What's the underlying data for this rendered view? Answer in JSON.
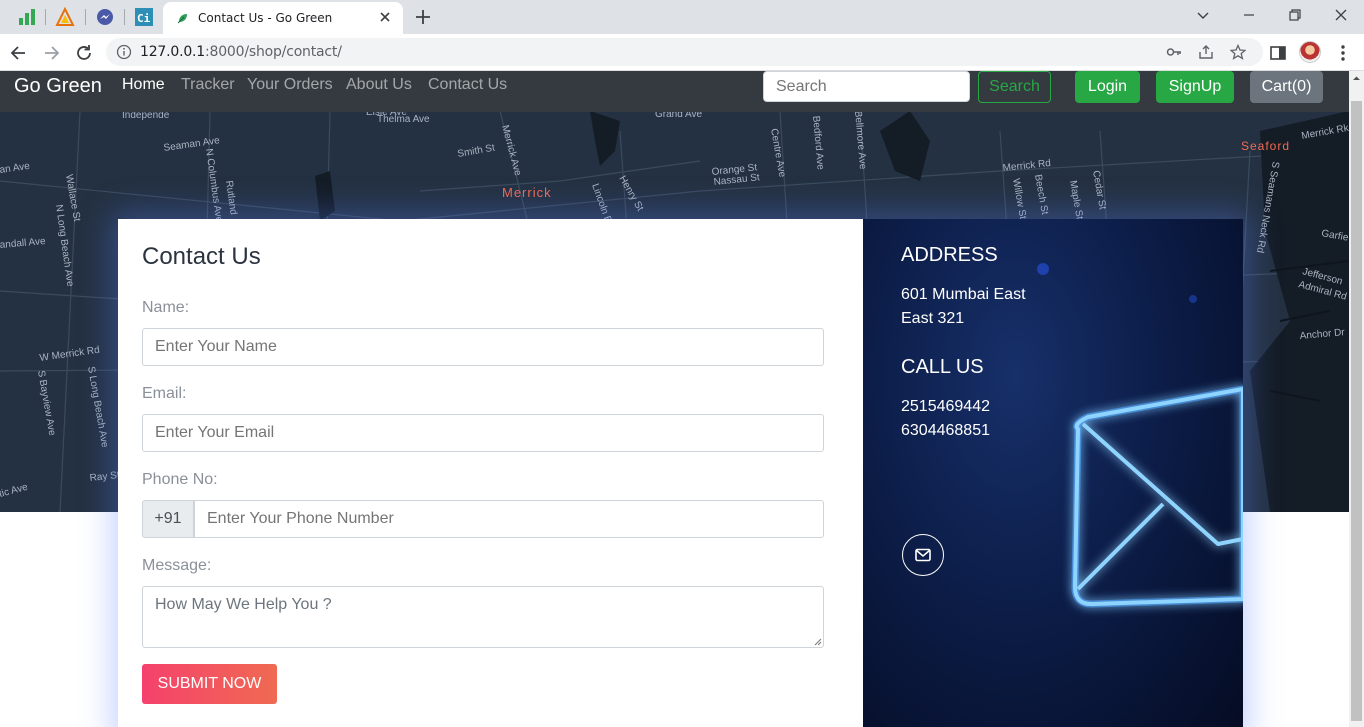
{
  "browser": {
    "tab_title": "Contact Us - Go Green",
    "url_host": "127.0.0.1",
    "url_path": ":8000/shop/contact/"
  },
  "navbar": {
    "brand": "Go Green",
    "links": [
      "Home",
      "Tracker",
      "Your Orders",
      "About Us",
      "Contact Us"
    ],
    "active_link": "Home",
    "search_placeholder": "Search",
    "search_button": "Search",
    "login_button": "Login",
    "signup_button": "SignUp",
    "cart_button": "Cart(0)"
  },
  "map_labels": [
    "Independe",
    "Elsie Ave",
    "Thelma Ave",
    "Grand Ave",
    "Seaman Ave",
    "Smith St",
    "Merrick Ave",
    "Centre Ave",
    "Bedford Ave",
    "Bellmore Ave",
    "Merrick Rd",
    "Seaford",
    "Merrick Rk",
    "an Ave",
    "Wallace St",
    "N Columbus Ave",
    "Rutland",
    "N Long Beach Ave",
    "andall Ave",
    "Orange St",
    "Nassau St",
    "Merrick",
    "Henry St",
    "Lincoln Bl",
    "S Seamans Neck Rd",
    "Garfie",
    "Jefferson",
    "Admiral Rd",
    "Anchor Dr",
    "W Merrick Rd",
    "S Bayview Ave",
    "S Long Beach Ave",
    "Ray St",
    "tic Ave",
    "Willow St",
    "Beech St",
    "Maple St",
    "Cedar St"
  ],
  "contact": {
    "title": "Contact Us",
    "name_label": "Name:",
    "name_placeholder": "Enter Your Name",
    "email_label": "Email:",
    "email_placeholder": "Enter Your Email",
    "phone_label": "Phone No:",
    "phone_prefix": "+91",
    "phone_placeholder": "Enter Your Phone Number",
    "message_label": "Message:",
    "message_placeholder": "How May We Help You ?",
    "submit_label": "SUBMIT NOW"
  },
  "info": {
    "address_heading": "ADDRESS",
    "address_line1": "601 Mumbai East",
    "address_line2": "East 321",
    "call_heading": "CALL US",
    "phone1": "2515469442",
    "phone2": "6304468851"
  },
  "colors": {
    "navbar_bg": "#343a40",
    "success": "#28a745",
    "secondary": "#6c757d",
    "submit_start": "#f5416c",
    "submit_end": "#f06a52",
    "map_bg": "#243142"
  }
}
